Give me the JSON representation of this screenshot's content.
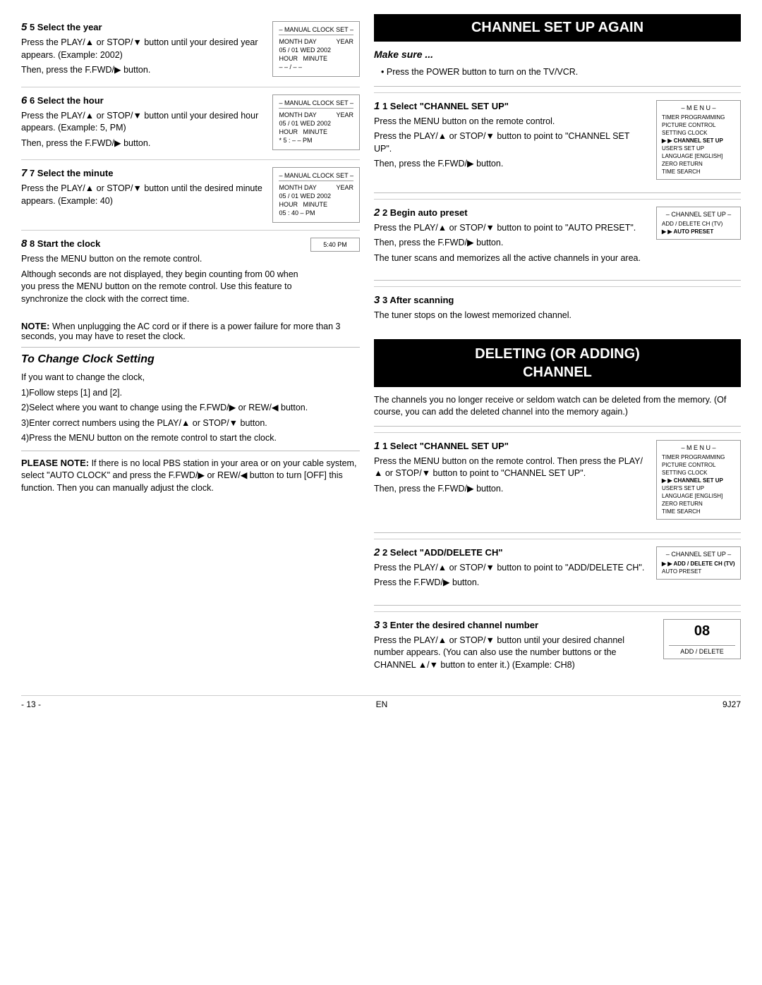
{
  "page": {
    "title": "CHANNEL SET UP AGAIN",
    "title2": "DELETING (OR ADDING) CHANNEL",
    "footer": {
      "page_num": "- 13 -",
      "lang": "EN",
      "model": "9J27"
    }
  },
  "left": {
    "step5": {
      "title": "5  Select the year",
      "body1": "Press the PLAY/▲ or STOP/▼ button until your desired year appears. (Example: 2002)",
      "body2": "Then, press the F.FWD/▶ button.",
      "display": {
        "title": "– MANUAL CLOCK SET –",
        "row1_label": "MONTH  DAY",
        "row1_val": "YEAR",
        "row2_val": "05 / 01  WED 2002",
        "row3_label": "HOUR   MINUTE",
        "row4_val": "– –  / – –"
      }
    },
    "step6": {
      "title": "6  Select the hour",
      "body1": "Press the PLAY/▲ or STOP/▼ button until your desired hour appears. (Example: 5, PM)",
      "body2": "Then, press the F.FWD/▶ button.",
      "display": {
        "title": "– MANUAL CLOCK SET –",
        "row1_label": "MONTH  DAY",
        "row1_val": "YEAR",
        "row2_val": "05 / 01  WED 2002",
        "row3_label": "HOUR   MINUTE",
        "row4_val": "* 5 : – – PM"
      }
    },
    "step7": {
      "title": "7  Select the minute",
      "body1": "Press the PLAY/▲ or STOP/▼ button until the desired minute appears. (Example: 40)",
      "display": {
        "title": "– MANUAL CLOCK SET –",
        "row1_label": "MONTH  DAY",
        "row1_val": "YEAR",
        "row2_val": "05 / 01  WED 2002",
        "row3_label": "HOUR   MINUTE",
        "row4_val": "05 : 40 – PM"
      }
    },
    "step8": {
      "title": "8  Start the clock",
      "body1": "Press the MENU button on the remote control.",
      "body2": "Although seconds are not displayed, they begin counting from 00 when you press the MENU button on the remote control. Use this feature to synchronize the clock with the correct time.",
      "clock_val": "5:40 PM"
    },
    "note": {
      "label": "NOTE:",
      "text": "When unplugging the AC cord or if there is a power failure for more than 3 seconds, you may have to reset the clock."
    },
    "to_change": {
      "title": "To Change Clock Setting",
      "items": [
        "If you want to change the clock,",
        "1)Follow steps [1] and [2].",
        "2)Select where you want to change using the F.FWD/▶ or REW/◀ button.",
        "3)Enter correct numbers using the PLAY/▲ or STOP/▼ button.",
        "4)Press the MENU button on the remote control to start the clock."
      ]
    },
    "please_note": {
      "label": "PLEASE NOTE:",
      "text": "If there is no local PBS station in your area or on your cable system, select \"AUTO CLOCK\" and press the F.FWD/▶ or REW/◀ button to turn [OFF] this function. Then you can manually adjust the clock."
    }
  },
  "right": {
    "make_sure": {
      "title": "Make sure ...",
      "bullet": "Press the POWER button to turn on the TV/VCR."
    },
    "step1_channel": {
      "title": "1  Select \"CHANNEL SET UP\"",
      "body1": "Press the MENU button on the remote control.",
      "body2": "Press the PLAY/▲ or STOP/▼ button to point to \"CHANNEL SET UP\".",
      "body3": "Then, press the F.FWD/▶ button.",
      "menu": {
        "title": "– M E N U –",
        "items": [
          "TIMER PROGRAMMING",
          "PICTURE CONTROL",
          "SETTING CLOCK",
          "CHANNEL SET UP",
          "USER'S SET UP",
          "LANGUAGE [ENGLISH]",
          "ZERO RETURN",
          "TIME SEARCH"
        ],
        "selected": "CHANNEL SET UP"
      }
    },
    "step2_auto": {
      "title": "2  Begin auto preset",
      "body1": "Press the PLAY/▲ or STOP/▼ button to point to \"AUTO PRESET\".",
      "body2": "Then, press the F.FWD/▶ button.",
      "body3": "The tuner scans and memorizes all the active channels in your area.",
      "menu": {
        "title": "– CHANNEL SET UP –",
        "items": [
          "ADD / DELETE CH (TV)",
          "AUTO PRESET"
        ],
        "selected": "AUTO PRESET"
      }
    },
    "step3_after": {
      "title": "3  After scanning",
      "body": "The tuner stops on the lowest memorized channel."
    },
    "deleting_section": {
      "title": "DELETING (OR ADDING)\nCHANNEL",
      "intro": "The channels you no longer receive or seldom watch can be deleted from the memory. (Of course, you can add the deleted channel into the memory again.)"
    },
    "del_step1": {
      "title": "1  Select \"CHANNEL SET UP\"",
      "body1": "Press the MENU button on the remote control. Then press the PLAY/▲ or STOP/▼ button to point to \"CHANNEL SET UP\".",
      "body2": "Then, press the F.FWD/▶ button.",
      "menu": {
        "title": "– M E N U –",
        "items": [
          "TIMER PROGRAMMING",
          "PICTURE CONTROL",
          "SETTING CLOCK",
          "CHANNEL SET UP",
          "USER'S SET UP",
          "LANGUAGE [ENGLISH]",
          "ZERO RETURN",
          "TIME SEARCH"
        ],
        "selected": "CHANNEL SET UP"
      }
    },
    "del_step2": {
      "title": "2  Select \"ADD/DELETE CH\"",
      "body1": "Press the PLAY/▲ or STOP/▼ button to point to \"ADD/DELETE CH\".",
      "body2": "Press the F.FWD/▶ button.",
      "menu": {
        "title": "– CHANNEL SET UP –",
        "items": [
          "ADD / DELETE CH (TV)",
          "AUTO PRESET"
        ],
        "selected": "ADD / DELETE CH (TV)"
      }
    },
    "del_step3": {
      "title": "3  Enter the desired channel number",
      "body1": "Press the PLAY/▲ or STOP/▼ button until your desired channel number appears. (You can also use the number buttons  or the CHANNEL ▲/▼ button to enter it.) (Example: CH8)",
      "display": {
        "val": "08",
        "label": "ADD / DELETE"
      }
    }
  }
}
